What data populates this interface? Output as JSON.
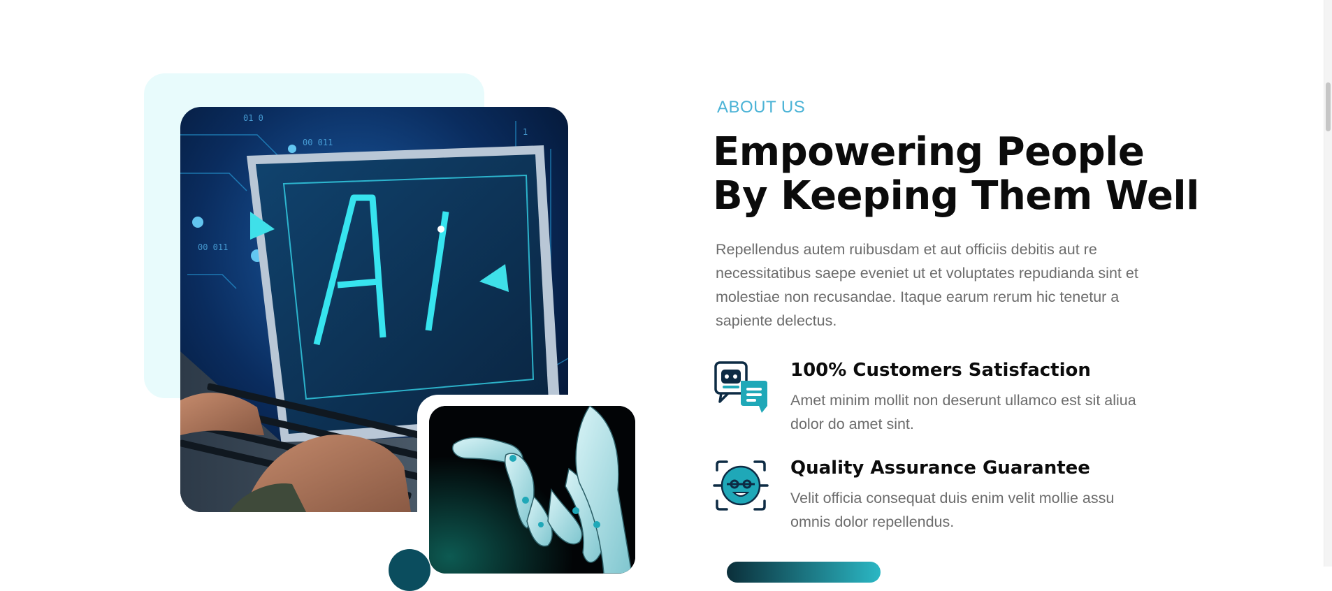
{
  "about": {
    "eyebrow": "ABOUT US",
    "heading_line1": "Empowering People",
    "heading_line2": "By Keeping Them Well",
    "intro": "Repellendus autem ruibusdam et aut officiis debitis aut re necessitatibus saepe eveniet ut et voluptates repudianda sint et molestiae non recusandae. Itaque earum rerum hic tenetur a sapiente delectus."
  },
  "features": [
    {
      "icon": "chatbot-icon",
      "title": "100% Customers Satisfaction",
      "text": "Amet minim mollit non deserunt ullamco est sit aliua dolor do amet sint."
    },
    {
      "icon": "face-scan-icon",
      "title": "Quality Assurance Guarantee",
      "text": "Velit officia consequat duis enim velit mollie assu omnis dolor repellendus."
    }
  ],
  "images": {
    "main": "laptop with AI hologram photo",
    "secondary": "robotic hand photo"
  },
  "colors": {
    "accent": "#4bb3d6",
    "heading": "#0b0b0b",
    "body_text": "#6c6c6c",
    "deco_bg": "#e8fbfc",
    "icon_teal": "#1fa8b8",
    "icon_navy": "#0d2b44"
  }
}
